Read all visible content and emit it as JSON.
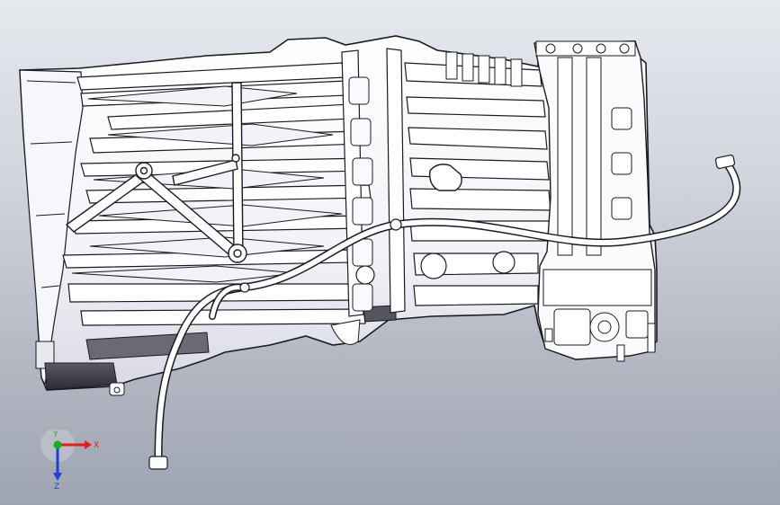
{
  "viewport": {
    "background_top": "#e6e9ee",
    "background_bottom": "#9ea4b0",
    "model_fill": "#fbfbfd",
    "model_shade": "#e5e6ee",
    "model_edge": "#1a1a22"
  },
  "triad": {
    "x_label": "X",
    "y_label": "Y",
    "z_label": "Z",
    "x_color": "#e02020",
    "y_color": "#18b018",
    "z_color": "#2040d0"
  }
}
